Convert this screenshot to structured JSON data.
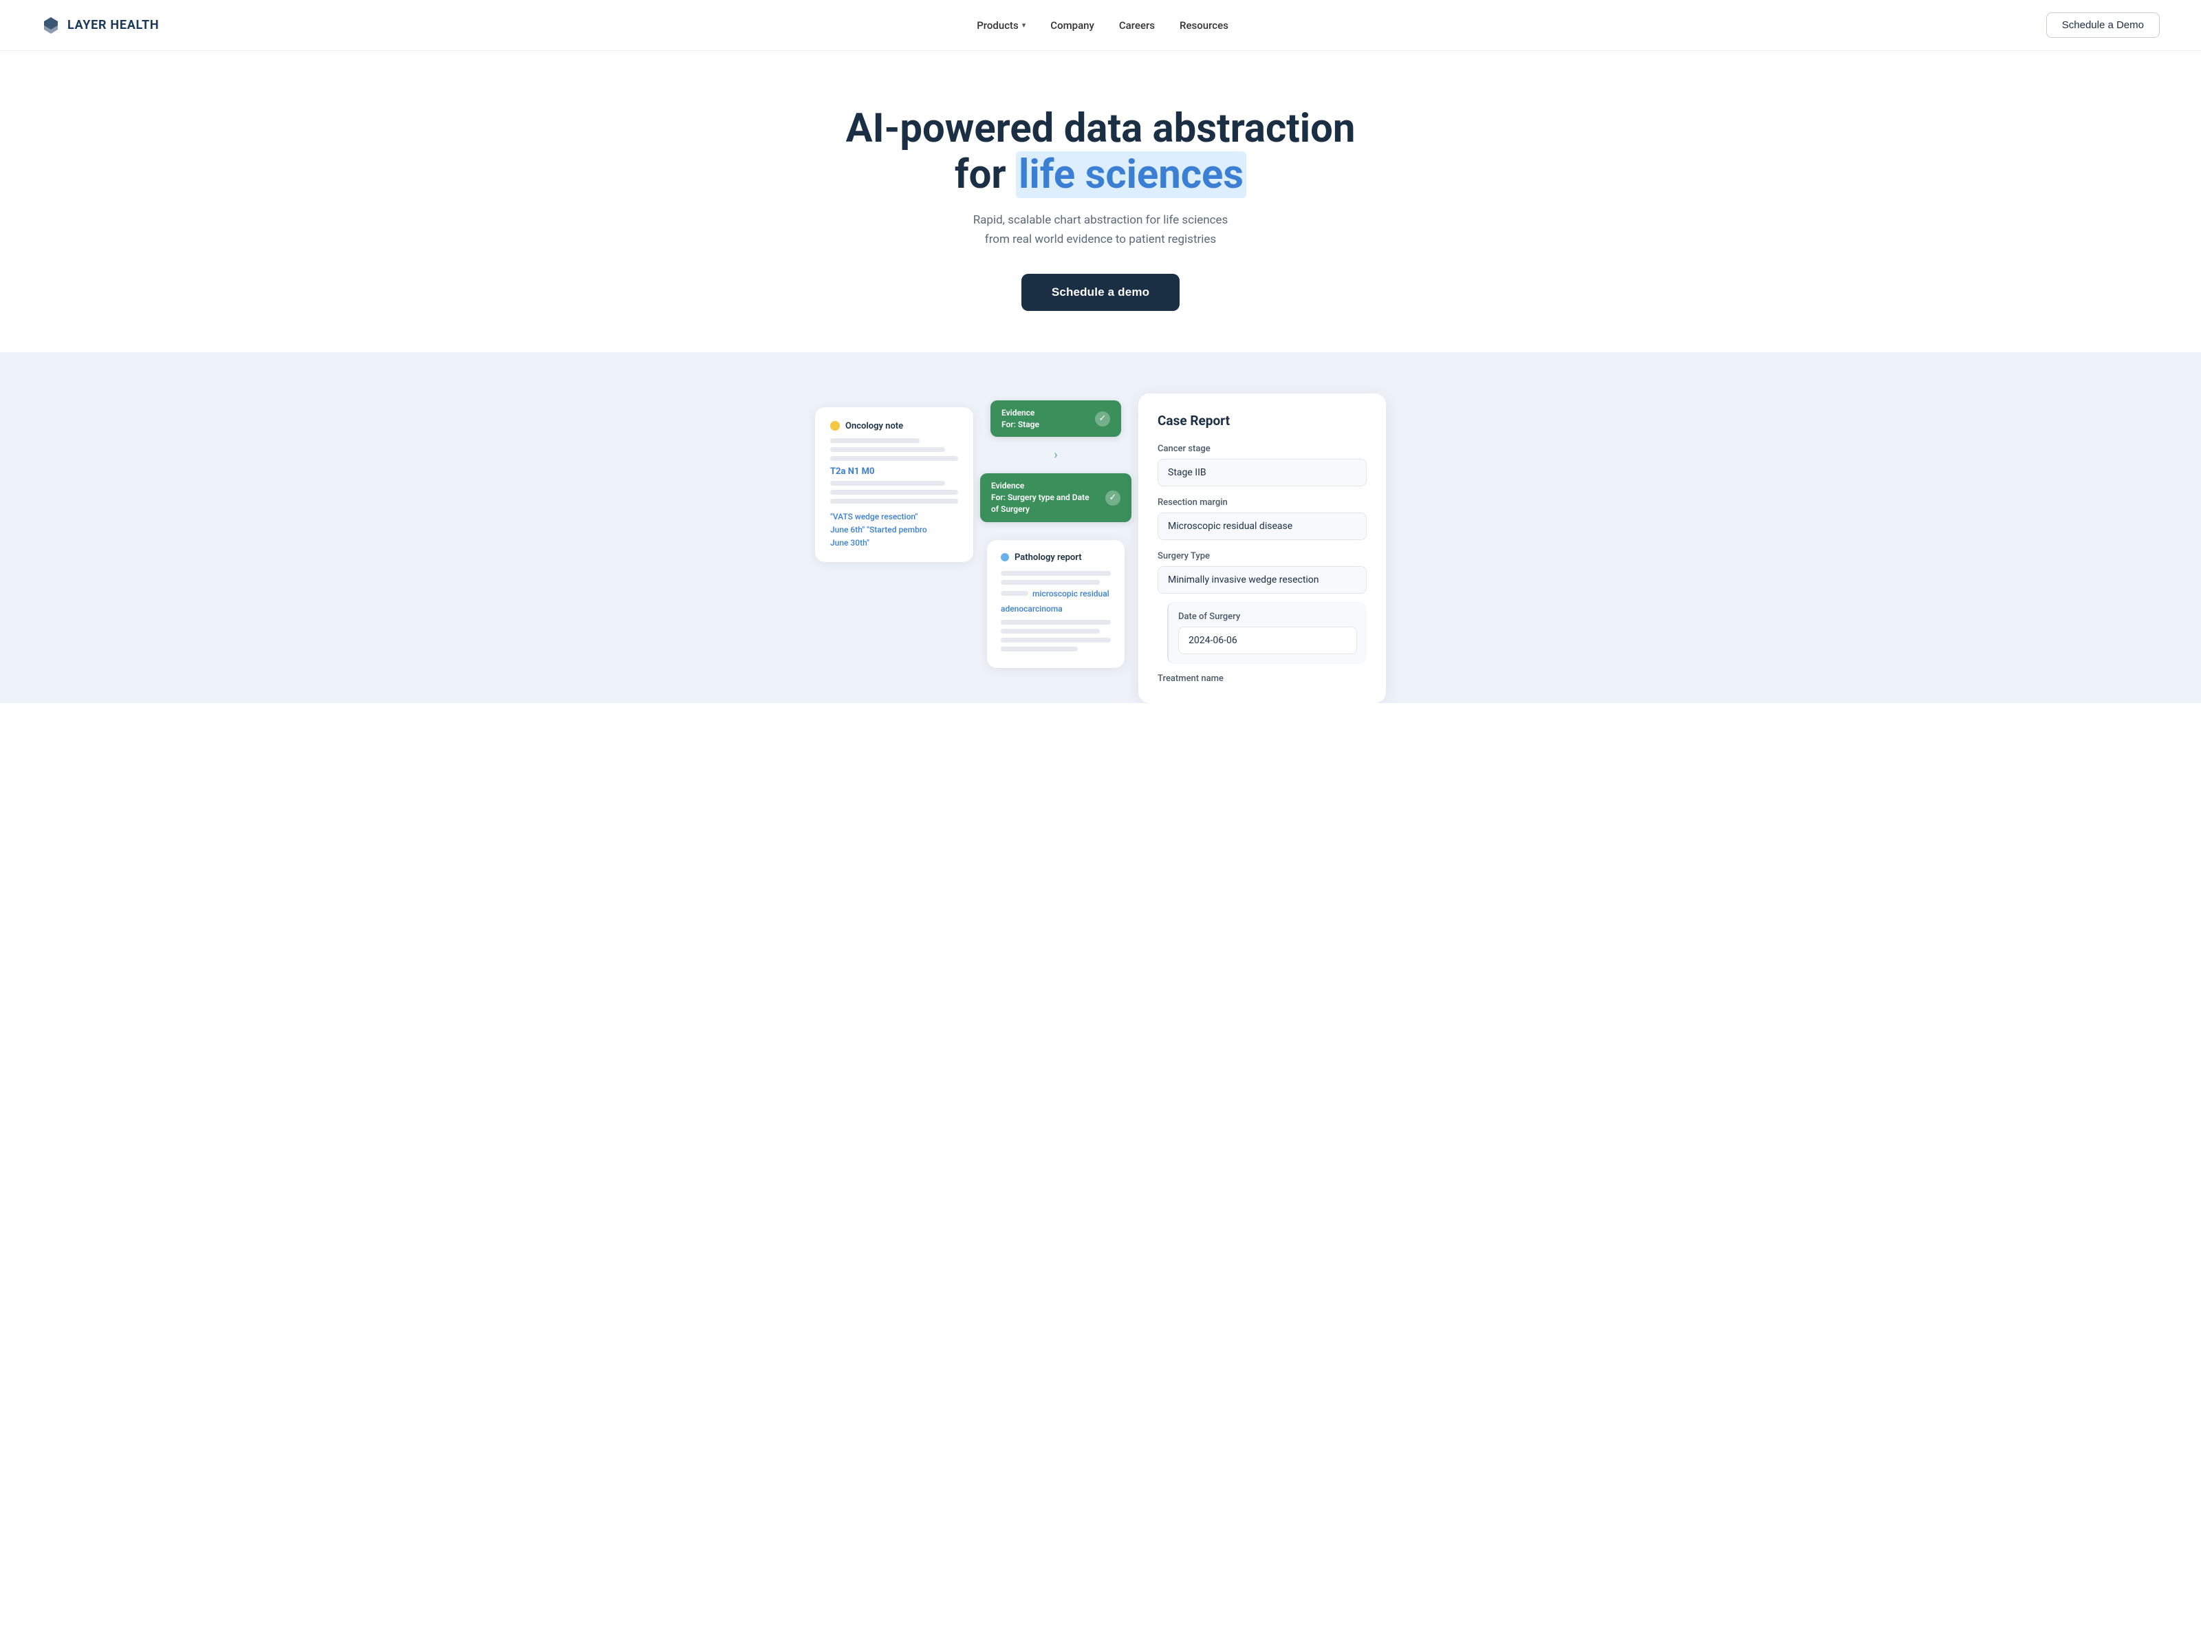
{
  "nav": {
    "logo_text": "LAYER HEALTH",
    "links": [
      {
        "label": "Products",
        "has_dropdown": true
      },
      {
        "label": "Company",
        "has_dropdown": false
      },
      {
        "label": "Careers",
        "has_dropdown": false
      },
      {
        "label": "Resources",
        "has_dropdown": false
      }
    ],
    "cta_label": "Schedule a Demo"
  },
  "hero": {
    "headline_part1": "AI-powered data abstraction",
    "headline_part2": "for ",
    "headline_highlight": "life sciences",
    "subtitle_line1": "Rapid, scalable chart abstraction for life sciences",
    "subtitle_line2": "from real world evidence to patient registries",
    "cta_label": "Schedule a demo"
  },
  "demo": {
    "oncology_card": {
      "title": "Oncology note",
      "stage_text": "T2a N1 M0",
      "vats_text": "\"VATS wedge resection\"",
      "june6_text": "June 6th\" \"Started pembro",
      "june30_text": "June 30th\""
    },
    "evidence_badge_1": {
      "label_line1": "Evidence",
      "label_line2": "For: Stage",
      "check": "✓"
    },
    "evidence_badge_2": {
      "label_line1": "Evidence",
      "label_line2": "For: Surgery type and Date of Surgery",
      "check": "✓"
    },
    "pathology_card": {
      "title": "Pathology report",
      "microscopic_text": "microscopic residual",
      "adenocarcinoma_text": "adenocarcinoma"
    },
    "case_report": {
      "title": "Case Report",
      "cancer_stage_label": "Cancer stage",
      "cancer_stage_value": "Stage IIB",
      "resection_margin_label": "Resection margin",
      "resection_margin_value": "Microscopic residual disease",
      "surgery_type_label": "Surgery Type",
      "surgery_type_value": "Minimally invasive wedge resection",
      "date_of_surgery_label": "Date of Surgery",
      "date_of_surgery_value": "2024-06-06",
      "treatment_name_label": "Treatment name"
    }
  }
}
